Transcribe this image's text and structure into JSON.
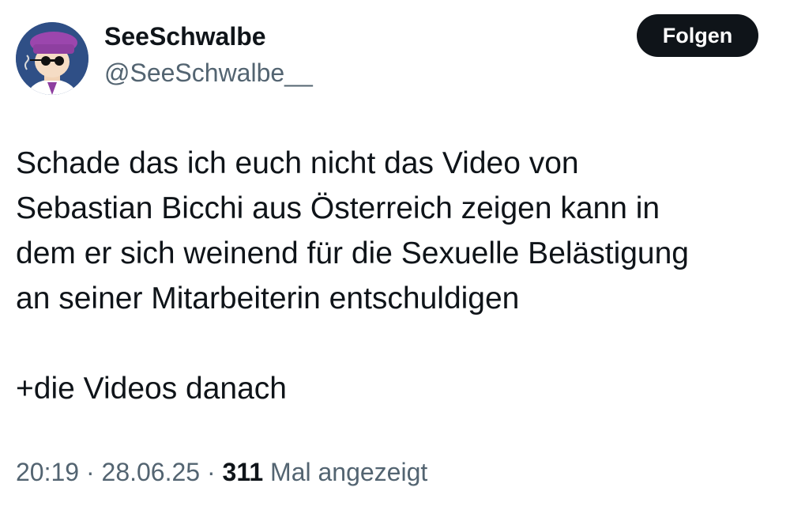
{
  "author": {
    "display_name": "SeeSchwalbe",
    "handle": "@SeeSchwalbe__",
    "avatar_icon": "avatar-illustration"
  },
  "follow_button": {
    "label": "Folgen"
  },
  "tweet": {
    "lines": [
      "Schade das ich euch nicht das Video von",
      "Sebastian Bicchi aus Österreich zeigen kann in",
      "dem er sich weinend für die Sexuelle Belästigung",
      "an seiner Mitarbeiterin entschuldigen"
    ],
    "extra_line": "+die Videos danach"
  },
  "meta": {
    "time": "20:19",
    "separator": "·",
    "date": "28.06.25",
    "views_count": "311",
    "views_label": "Mal angezeigt"
  },
  "colors": {
    "text_primary": "#0f1419",
    "text_secondary": "#536471",
    "button_bg": "#0f1419",
    "avatar_bg": "#2f4f86",
    "avatar_hat": "#8e3fa0"
  }
}
